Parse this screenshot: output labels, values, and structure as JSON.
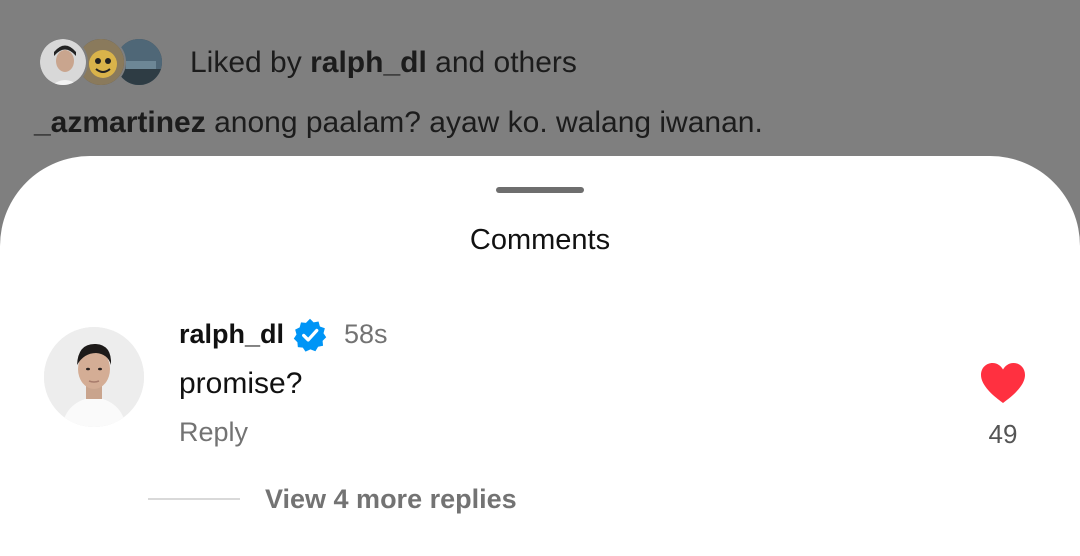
{
  "post": {
    "liked_by_prefix": "Liked by",
    "liked_by_user": "ralph_dl",
    "liked_by_suffix": "and others",
    "caption_user": "_azmartinez",
    "caption_text": "anong paalam? ayaw ko. walang iwanan."
  },
  "sheet": {
    "title": "Comments"
  },
  "comments": [
    {
      "username": "ralph_dl",
      "verified": true,
      "time": "58s",
      "text": "promise?",
      "reply_label": "Reply",
      "likes": "49",
      "liked": true,
      "view_replies_label": "View 4 more replies"
    }
  ],
  "colors": {
    "verified_badge": "#0095f6",
    "heart": "#ff3040",
    "dim_overlay": "#7f7f7f"
  },
  "icons": [
    "verified-badge-icon",
    "heart-icon"
  ]
}
